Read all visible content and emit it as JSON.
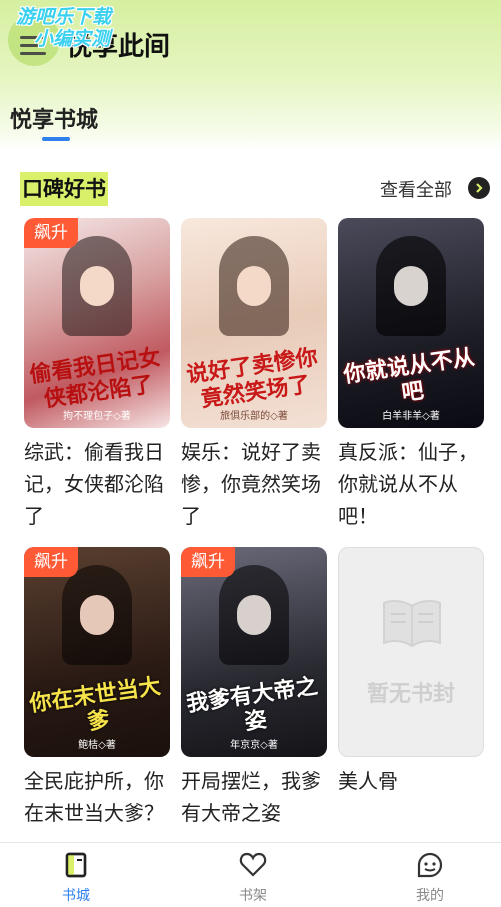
{
  "header": {
    "app_title": "悦享此间",
    "watermark_line1": "游吧乐下载",
    "watermark_line2": "小编实测"
  },
  "tabs": [
    {
      "label": "悦享书城"
    }
  ],
  "section": {
    "title": "口碑好书",
    "see_all": "查看全部"
  },
  "books": [
    {
      "badge": "飙升",
      "title": "综武：偷看我日记，女侠都沦陷了",
      "cover_title": "偷看我日记女侠都沦陷了",
      "cover_author": "拘不理包子◇著"
    },
    {
      "badge": "",
      "title": "娱乐：说好了卖惨，你竟然笑场了",
      "cover_title": "说好了卖惨你竟然笑场了",
      "cover_author": "旅俱乐部的◇著"
    },
    {
      "badge": "",
      "title": "真反派：仙子，你就说从不从吧！",
      "cover_title": "你就说从不从吧",
      "cover_author": "白羊非羊◇著"
    },
    {
      "badge": "飙升",
      "title": "全民庇护所，你在末世当大爹？",
      "cover_title": "你在末世当大爹",
      "cover_author": "鲍桔◇著"
    },
    {
      "badge": "飙升",
      "title": "开局摆烂，我爹有大帝之姿",
      "cover_title": "我爹有大帝之姿",
      "cover_author": "年京京◇著"
    },
    {
      "badge": "",
      "title": "美人骨",
      "cover_title": "暂无书封",
      "cover_author": ""
    }
  ],
  "bottom_nav": [
    {
      "label": "书城",
      "icon": "bookstore-icon",
      "active": true
    },
    {
      "label": "书架",
      "icon": "heart-icon",
      "active": false
    },
    {
      "label": "我的",
      "icon": "profile-icon",
      "active": false
    }
  ],
  "colors": {
    "accent": "#2f80ed",
    "badge": "#ff5a36",
    "highlight": "#d8f06a",
    "header": "#d6efa0"
  }
}
